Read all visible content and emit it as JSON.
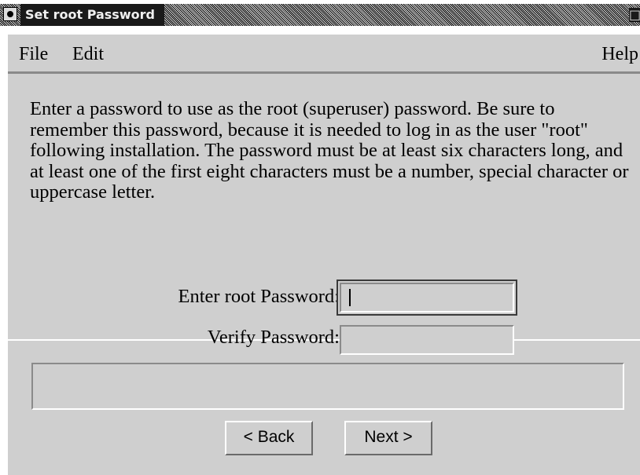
{
  "window": {
    "title": "Set root Password"
  },
  "menubar": {
    "file": "File",
    "edit": "Edit",
    "help": "Help"
  },
  "content": {
    "description": "Enter a password to use as the root (superuser) password. Be sure to remember this password, because it is needed to log in as the user \"root\" following installation.  The password must be at least six characters long, and at least one of the first eight characters must be a number, special character or uppercase letter.",
    "root_password_label": "Enter root Password:",
    "root_password_value": "",
    "verify_password_label": "Verify Password:",
    "verify_password_value": ""
  },
  "status": {
    "message": ""
  },
  "buttons": {
    "back": "< Back",
    "next": "Next >"
  },
  "icons": {
    "window_menu": "window-menu-icon",
    "maximize": "maximize-icon"
  },
  "colors": {
    "window_bg": "#cfcfcf",
    "titlebar_bg": "#1a1a1a",
    "text": "#000000"
  }
}
